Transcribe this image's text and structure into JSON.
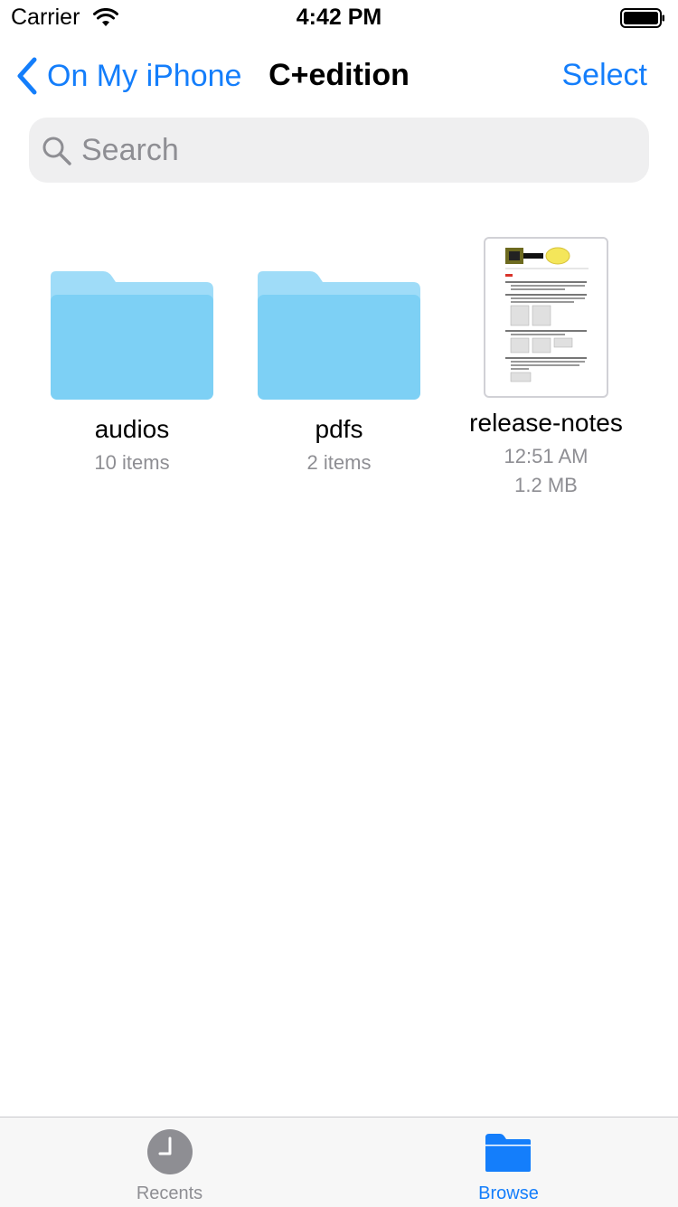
{
  "status_bar": {
    "carrier": "Carrier",
    "time": "4:42 PM"
  },
  "nav": {
    "back_label": "On My iPhone",
    "title": "C+edition",
    "select_label": "Select"
  },
  "search": {
    "placeholder": "Search"
  },
  "items": [
    {
      "name": "audios",
      "meta1": "10 items",
      "meta2": "",
      "icon": "folder-icon"
    },
    {
      "name": "pdfs",
      "meta1": "2 items",
      "meta2": "",
      "icon": "folder-icon"
    },
    {
      "name": "release-notes",
      "meta1": "12:51 AM",
      "meta2": "1.2 MB",
      "icon": "pdf-thumbnail"
    }
  ],
  "tabs": [
    {
      "label": "Recents",
      "icon": "clock-icon",
      "selected": false
    },
    {
      "label": "Browse",
      "icon": "folder-icon",
      "selected": true
    }
  ],
  "colors": {
    "accent": "#147efb",
    "folder": "#7dd0f5",
    "inactive_tab": "#8e8e93"
  }
}
